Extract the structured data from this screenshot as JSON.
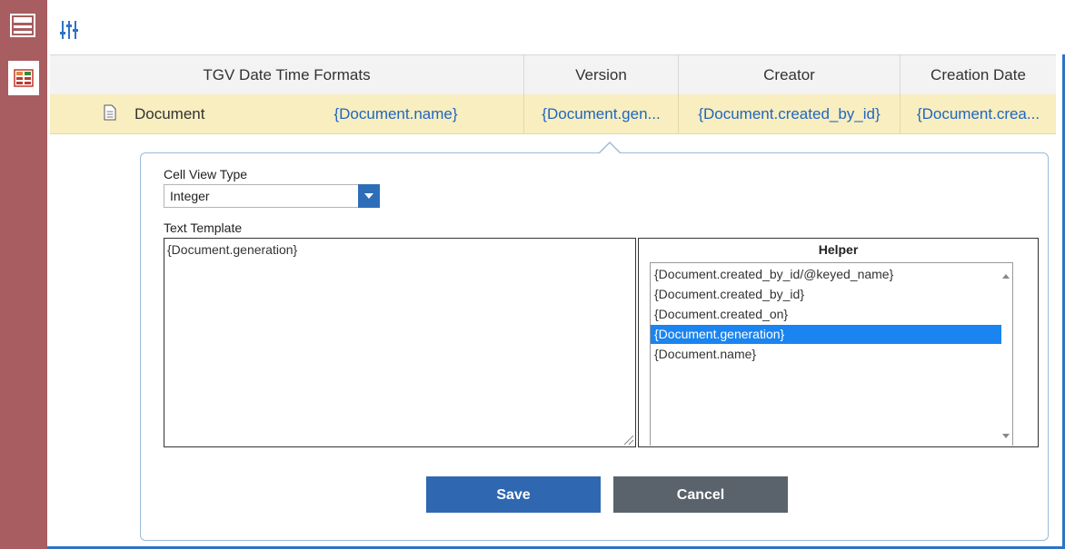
{
  "toolbar": {
    "icons": [
      "grid-icon",
      "column-layout-icon",
      "settings-sliders-icon"
    ]
  },
  "grid": {
    "headers": [
      "TGV Date Time Formats",
      "Version",
      "Creator",
      "Creation Date"
    ],
    "row": {
      "type_label": "Document",
      "cells": [
        "{Document.name}",
        "{Document.gen...",
        "{Document.created_by_id}",
        "{Document.crea..."
      ]
    },
    "colors": {
      "row_highlight": "#f8eebf",
      "link_text": "#1f66c3"
    }
  },
  "editor": {
    "cell_view_type_label": "Cell View Type",
    "cell_view_type_value": "Integer",
    "text_template_label": "Text Template",
    "text_template_value": "{Document.generation}",
    "helper_title": "Helper",
    "helper_items": [
      "{Document.created_by_id/@keyed_name}",
      "{Document.created_by_id}",
      "{Document.created_on}",
      "{Document.generation}",
      "{Document.name}"
    ],
    "helper_selected_index": 3,
    "save_label": "Save",
    "cancel_label": "Cancel",
    "colors": {
      "save": "#2f68b1",
      "cancel": "#5a636b",
      "selected": "#1a84f0"
    }
  }
}
